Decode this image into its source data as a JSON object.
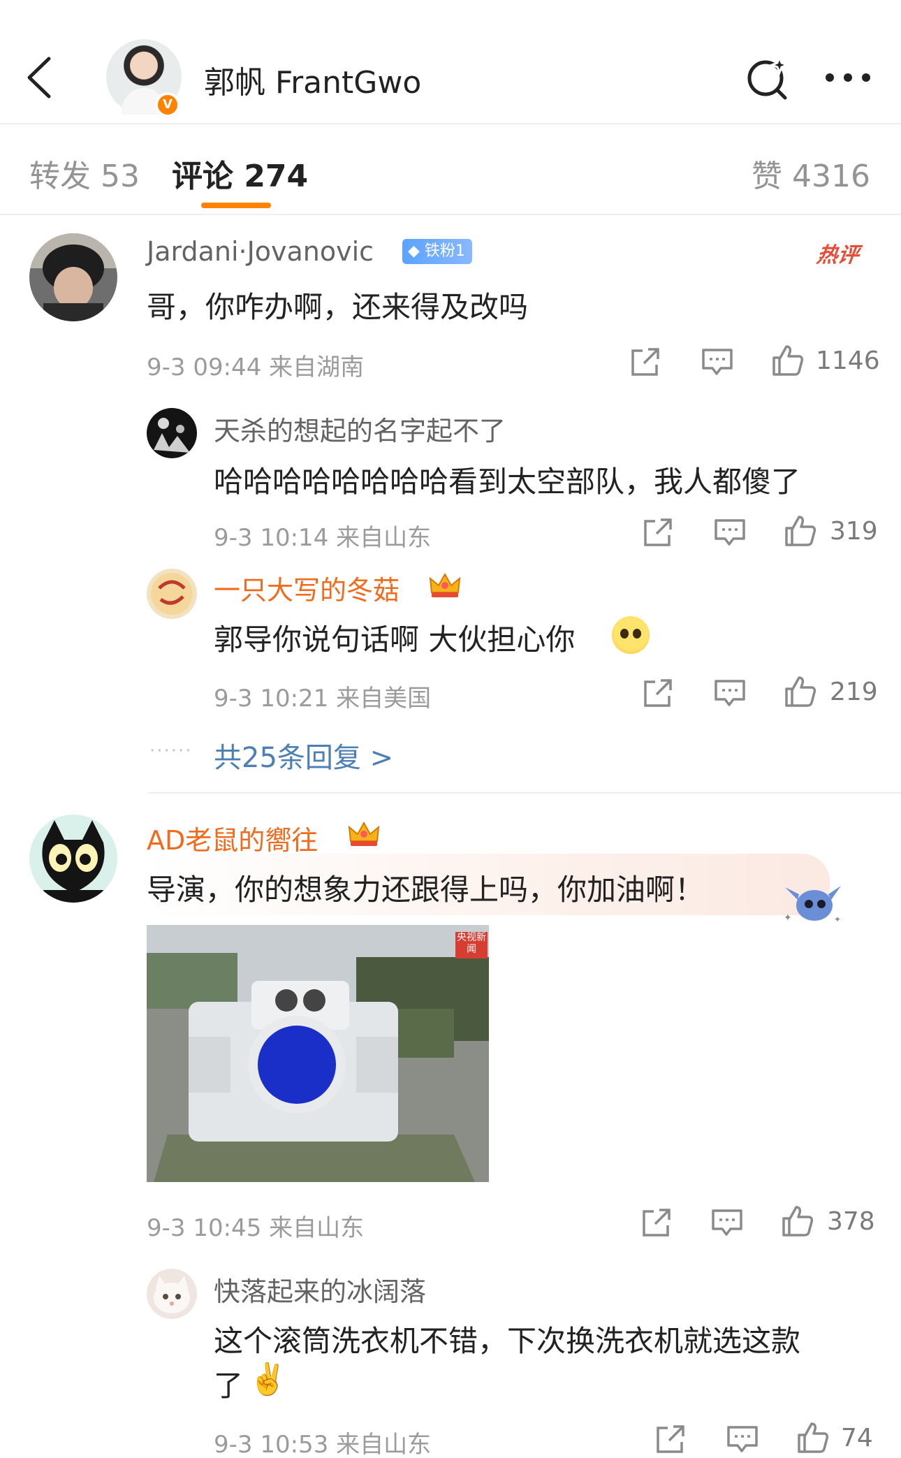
{
  "header": {
    "title": "郭帆 FrantGwo",
    "verified_badge": "V",
    "icons": {
      "back": "chevron-left-icon",
      "search": "search-sparkle-icon",
      "more": "more-dots-icon"
    }
  },
  "tabs": {
    "repost": "转发 53",
    "comment": "评论 274",
    "like": "赞 4316",
    "accent_color": "#ff8200"
  },
  "comments": [
    {
      "name": "Jardani·Jovanovic",
      "fan_badge": "铁粉1",
      "hot_tag": "热评",
      "text": "哥，你咋办啊，还来得及改吗",
      "meta": "9-3 09:44  来自湖南",
      "likes": "1146",
      "replies": [
        {
          "name": "天杀的想起的名字起不了",
          "text": "哈哈哈哈哈哈哈哈看到太空部队，我人都傻了",
          "meta": "9-3 10:14  来自山东",
          "likes": "319"
        },
        {
          "name": "一只大写的冬菇",
          "text": "郭导你说句话啊 大伙担心你",
          "meta": "9-3 10:21  来自美国",
          "likes": "219"
        }
      ],
      "more_replies": "共25条回复 >"
    },
    {
      "name": "AD老鼠的嚮往",
      "text": "导演，你的想象力还跟得上吗，你加油啊！",
      "image_tag": "央视新闻",
      "meta": "9-3 10:45  来自山东",
      "likes": "378",
      "replies": [
        {
          "name": "快落起来的冰阔落",
          "text": "这个滚筒洗衣机不错，下次换洗衣机就选这款",
          "text2": "了",
          "meta": "9-3 10:53  来自山东",
          "likes": "74"
        }
      ]
    }
  ]
}
